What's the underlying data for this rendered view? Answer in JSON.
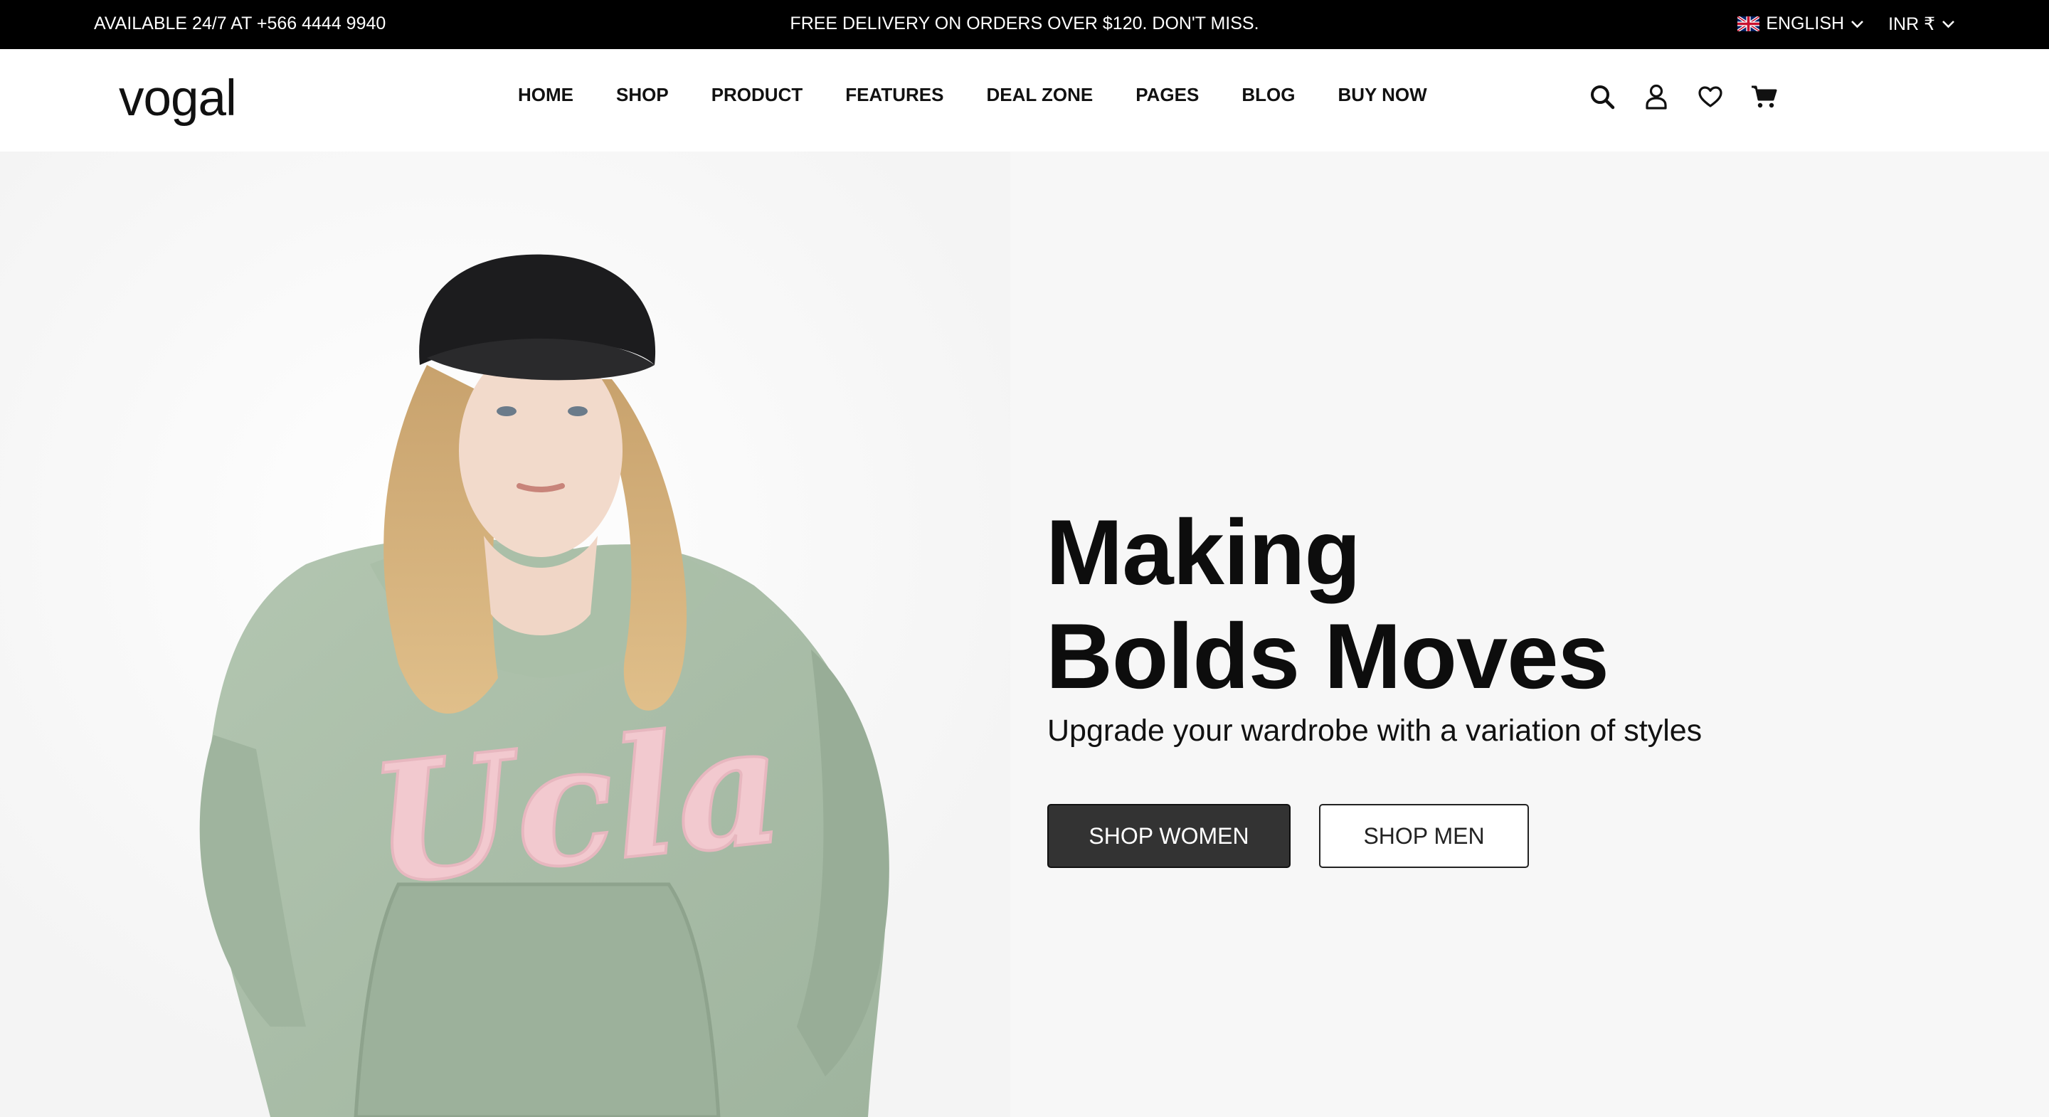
{
  "topbar": {
    "availability": "AVAILABLE 24/7 AT +566 4444 9940",
    "promo": "FREE DELIVERY ON ORDERS OVER $120. DON'T MISS.",
    "language": "ENGLISH",
    "currency": "INR ₹"
  },
  "header": {
    "logo": "vogal",
    "nav": [
      "HOME",
      "SHOP",
      "PRODUCT",
      "FEATURES",
      "DEAL ZONE",
      "PAGES",
      "BLOG",
      "BUY NOW"
    ],
    "icons": [
      "search-icon",
      "user-icon",
      "heart-icon",
      "cart-icon"
    ]
  },
  "hero": {
    "headline_line1": "Making",
    "headline_line2": "Bolds Moves",
    "subheadline": "Upgrade your wardrobe with a variation of styles",
    "primary_button": "SHOP WOMEN",
    "secondary_button": "SHOP MEN",
    "image_sweatshirt_text": "Ucla"
  },
  "colors": {
    "topbar_bg": "#000000",
    "hero_bg": "#f7f7f7",
    "primary_button_bg": "#333333",
    "sweatshirt": "#a7bca6",
    "sweatshirt_lettering": "#f2c9cf"
  }
}
